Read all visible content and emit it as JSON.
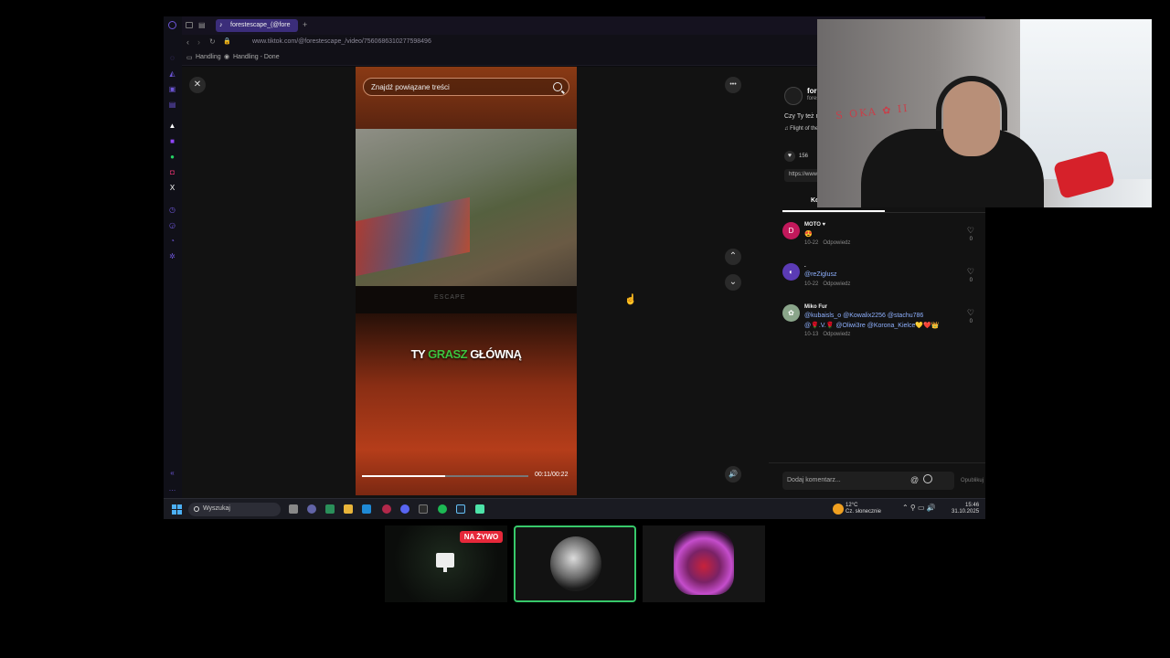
{
  "browser": {
    "tab_title": "forestescape_(@fore",
    "new_tab": "+",
    "url": "www.tiktok.com/@forestescape_/video/7560686310277598496",
    "bookmarks": [
      "Handling",
      "Handling - Done"
    ]
  },
  "video": {
    "search_placeholder": "Znajdź powiązane treści",
    "caption_1": "TY ",
    "caption_2": "GRASZ",
    "caption_3": " GŁÓWNĄ",
    "watermark": "ESCAPE",
    "time": "00:11/00:22",
    "progress": 0.5
  },
  "controls": {
    "close": "✕",
    "more": "•••",
    "up": "⌃",
    "down": "⌄",
    "volume": "🔊"
  },
  "panel": {
    "creator": "foreste",
    "creator_sub": "forestesca",
    "description": "Czy Ty też masz",
    "music": "♫  Flight of the Si",
    "likes": "156",
    "link": "https://www.tikto",
    "tab": "Komen",
    "comments": [
      {
        "avatar": "D",
        "avatar_color": "#c2185b",
        "user": "MOTO ♥",
        "text": "😍",
        "text2": "",
        "date": "10-22",
        "reply": "Odpowiedz",
        "likes": "0"
      },
      {
        "avatar": "◐",
        "avatar_color": "#5b3bb5",
        "user": ".",
        "text": "@reZiglusz",
        "text2": "",
        "date": "10-22",
        "reply": "Odpowiedz",
        "likes": "0"
      },
      {
        "avatar": "✿",
        "avatar_color": "#8aa58a",
        "user": "Miko Fur",
        "text": "@kubaisls_o @Kowalix2256 @stachu786",
        "text2": "@🌹.V.🌹 @Oliwi3re @Korona_Kielce💛❤️👑",
        "date": "10-13",
        "reply": "Odpowiedz",
        "likes": "0"
      }
    ],
    "comment_placeholder": "Dodaj komentarz...",
    "publish": "Opublikuj"
  },
  "taskbar": {
    "search": "Wyszukaj",
    "temp": "12°C",
    "weather": "Cz. słonecznie",
    "time": "15:46",
    "date": "31.10.2025"
  },
  "webcam": {
    "scribble": "S OKA ✿ II"
  },
  "thumbnails": {
    "live": "NA ŻYWO"
  }
}
